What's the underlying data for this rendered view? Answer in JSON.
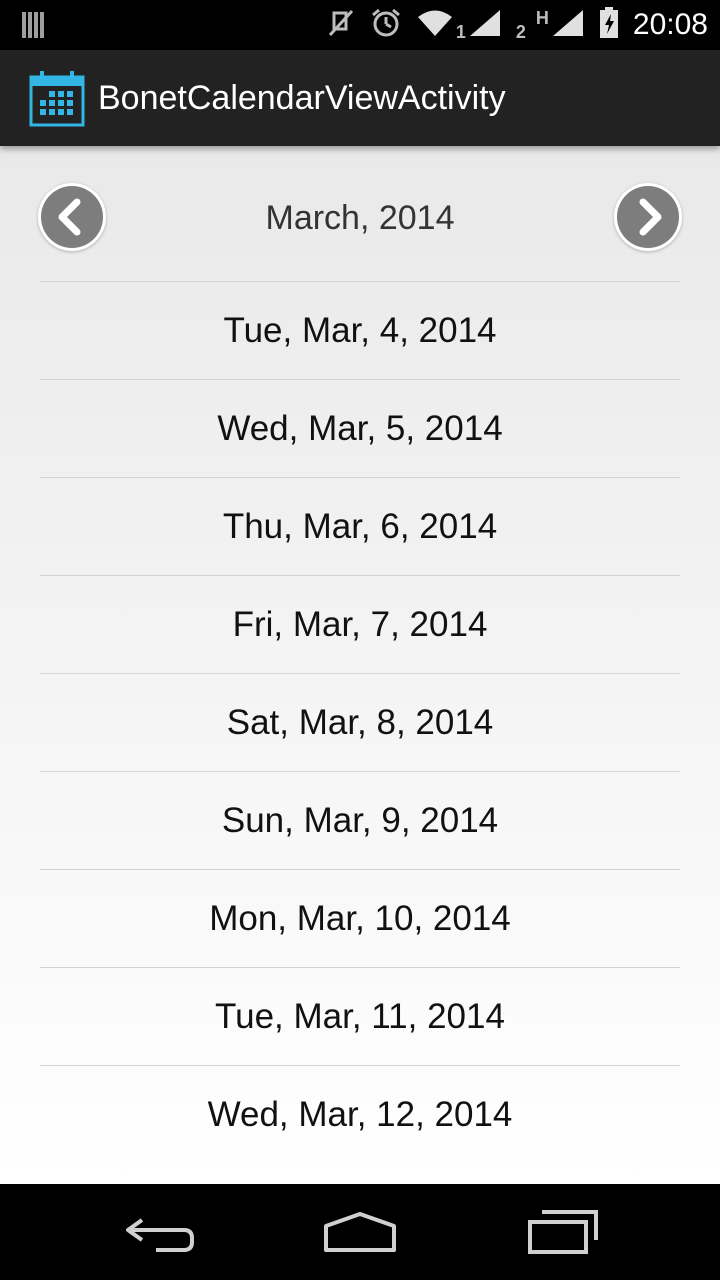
{
  "status_bar": {
    "time": "20:08",
    "sim1_label": "1",
    "sim2_label": "2",
    "network_label": "H",
    "icons": [
      "notification-bars-icon",
      "mute-icon",
      "alarm-icon",
      "wifi-icon",
      "signal-icon",
      "signal-icon",
      "battery-charging-icon"
    ]
  },
  "action_bar": {
    "title": "BonetCalendarViewActivity",
    "icon": "calendar-icon",
    "accent_color": "#33b5e5"
  },
  "calendar": {
    "month_title": "March, 2014",
    "prev_icon": "chevron-left-icon",
    "next_icon": "chevron-right-icon",
    "dates": [
      {
        "label": "Tue, Mar, 4, 2014"
      },
      {
        "label": "Wed, Mar, 5, 2014"
      },
      {
        "label": "Thu, Mar, 6, 2014"
      },
      {
        "label": "Fri, Mar, 7, 2014"
      },
      {
        "label": "Sat, Mar, 8, 2014"
      },
      {
        "label": "Sun, Mar, 9, 2014"
      },
      {
        "label": "Mon, Mar, 10, 2014"
      },
      {
        "label": "Tue, Mar, 11, 2014"
      },
      {
        "label": "Wed, Mar, 12, 2014"
      }
    ]
  },
  "nav_bar": {
    "icons": [
      "back-icon",
      "home-icon",
      "recent-apps-icon"
    ]
  }
}
